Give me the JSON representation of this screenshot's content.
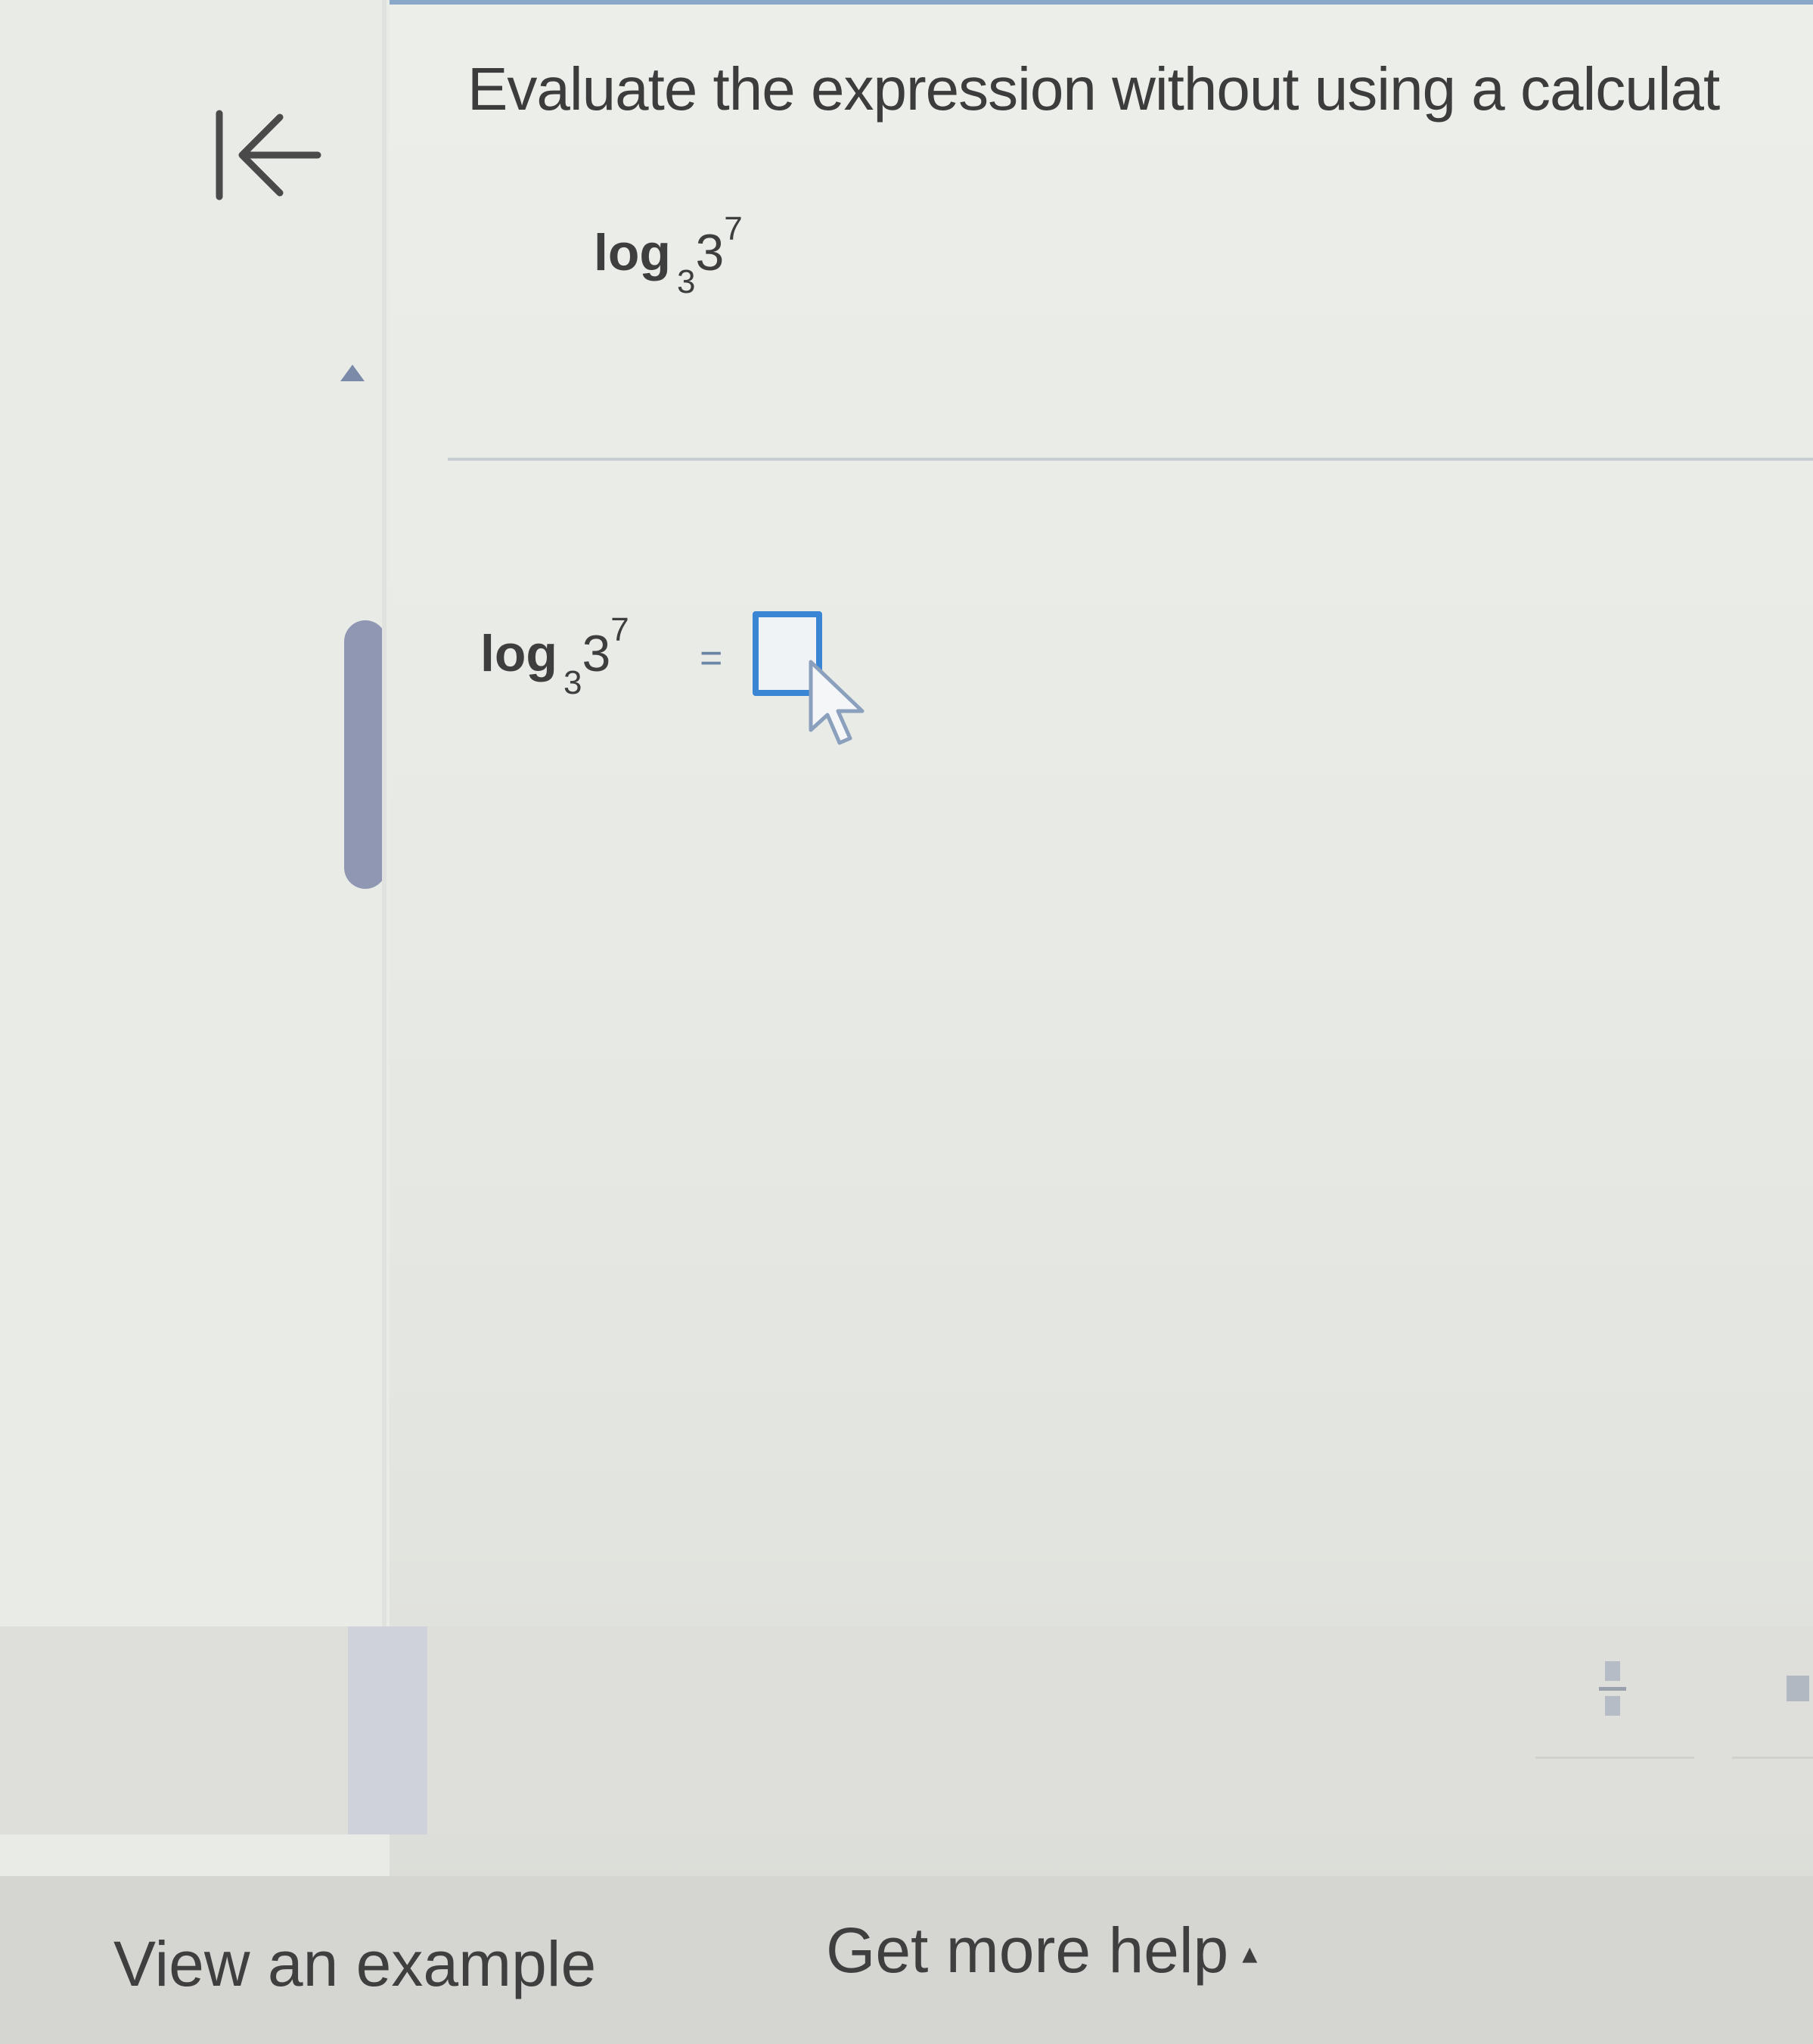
{
  "question": {
    "instruction": "Evaluate the expression without using a calculat",
    "expression": {
      "func": "log",
      "base": "3",
      "number": "3",
      "exponent": "7"
    }
  },
  "answer": {
    "func": "log",
    "base": "3",
    "number": "3",
    "exponent": "7",
    "equals": "=",
    "input_value": ""
  },
  "footer": {
    "view_example": "View an example",
    "get_more_help": "Get more help",
    "help_caret": "▴"
  },
  "icons": {
    "back": "first-page-arrow-icon",
    "collapse": "collapse-triangle-icon",
    "cursor": "mouse-pointer-icon",
    "fraction": "fraction-template-icon",
    "square": "square-template-icon"
  },
  "colors": {
    "accent": "#3a86d4",
    "scroll_thumb": "#9097b3",
    "text": "#3c3c3c"
  }
}
